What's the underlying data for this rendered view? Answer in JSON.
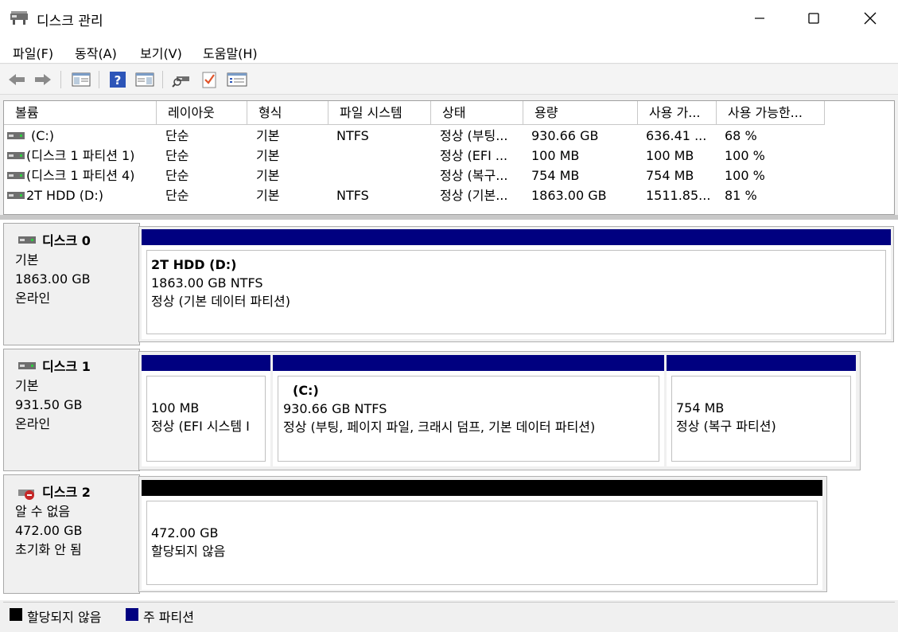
{
  "window": {
    "title": "디스크 관리",
    "controls": [
      "minimize-icon",
      "maximize-icon",
      "close-icon"
    ]
  },
  "menu": [
    {
      "label": "파일(F)"
    },
    {
      "label": "동작(A)"
    },
    {
      "label": "보기(V)"
    },
    {
      "label": "도움말(H)"
    }
  ],
  "toolbar": {
    "icons": [
      "back-arrow-icon",
      "forward-arrow-icon",
      "show-hide-console-tree-icon",
      "help-icon",
      "show-hide-action-pane-icon",
      "rescan-disks-icon",
      "checklist-icon",
      "properties-icon"
    ]
  },
  "volume_table": {
    "columns": [
      "볼륨",
      "레이아웃",
      "형식",
      "파일 시스템",
      "상태",
      "용량",
      "사용 가...",
      "사용 가능한..."
    ],
    "rows": [
      {
        "volume": "(C:)",
        "layout": "단순",
        "type": "기본",
        "fs": "NTFS",
        "status": "정상 (부팅...",
        "capacity": "930.66 GB",
        "free": "636.41 ...",
        "pct": "68 %"
      },
      {
        "volume": "(디스크 1 파티션 1)",
        "layout": "단순",
        "type": "기본",
        "fs": "",
        "status": "정상 (EFI ...",
        "capacity": "100 MB",
        "free": "100 MB",
        "pct": "100 %"
      },
      {
        "volume": "(디스크 1 파티션 4)",
        "layout": "단순",
        "type": "기본",
        "fs": "",
        "status": "정상 (복구...",
        "capacity": "754 MB",
        "free": "754 MB",
        "pct": "100 %"
      },
      {
        "volume": "2T HDD (D:)",
        "layout": "단순",
        "type": "기본",
        "fs": "NTFS",
        "status": "정상 (기본...",
        "capacity": "1863.00 GB",
        "free": "1511.85...",
        "pct": "81 %"
      }
    ]
  },
  "disks": [
    {
      "name": "디스크 0",
      "kind": "기본",
      "size": "1863.00 GB",
      "state": "온라인",
      "partitions": [
        {
          "name": "2T HDD  (D:)",
          "size_fs": "1863.00 GB NTFS",
          "status": "정상 (기본 데이터 파티션)",
          "bar_color": "#000080"
        }
      ]
    },
    {
      "name": "디스크 1",
      "kind": "기본",
      "size": "931.50 GB",
      "state": "온라인",
      "partitions": [
        {
          "name": "",
          "size_fs": "100 MB",
          "status": "정상 (EFI 시스템 I",
          "bar_color": "#000080"
        },
        {
          "name": "(C:)",
          "size_fs": "930.66 GB NTFS",
          "status": "정상 (부팅, 페이지 파일, 크래시 덤프, 기본 데이터 파티션)",
          "bar_color": "#000080"
        },
        {
          "name": "",
          "size_fs": "754 MB",
          "status": "정상 (복구 파티션)",
          "bar_color": "#000080"
        }
      ]
    },
    {
      "name": "디스크 2",
      "kind": "알 수 없음",
      "size": "472.00 GB",
      "state": "초기화 안 됨",
      "partitions": [
        {
          "name": "",
          "size_fs": "472.00 GB",
          "status": "할당되지 않음",
          "bar_color": "#000000"
        }
      ]
    }
  ],
  "legend": [
    {
      "label": "할당되지 않음",
      "color": "#000000"
    },
    {
      "label": "주 파티션",
      "color": "#000080"
    }
  ]
}
